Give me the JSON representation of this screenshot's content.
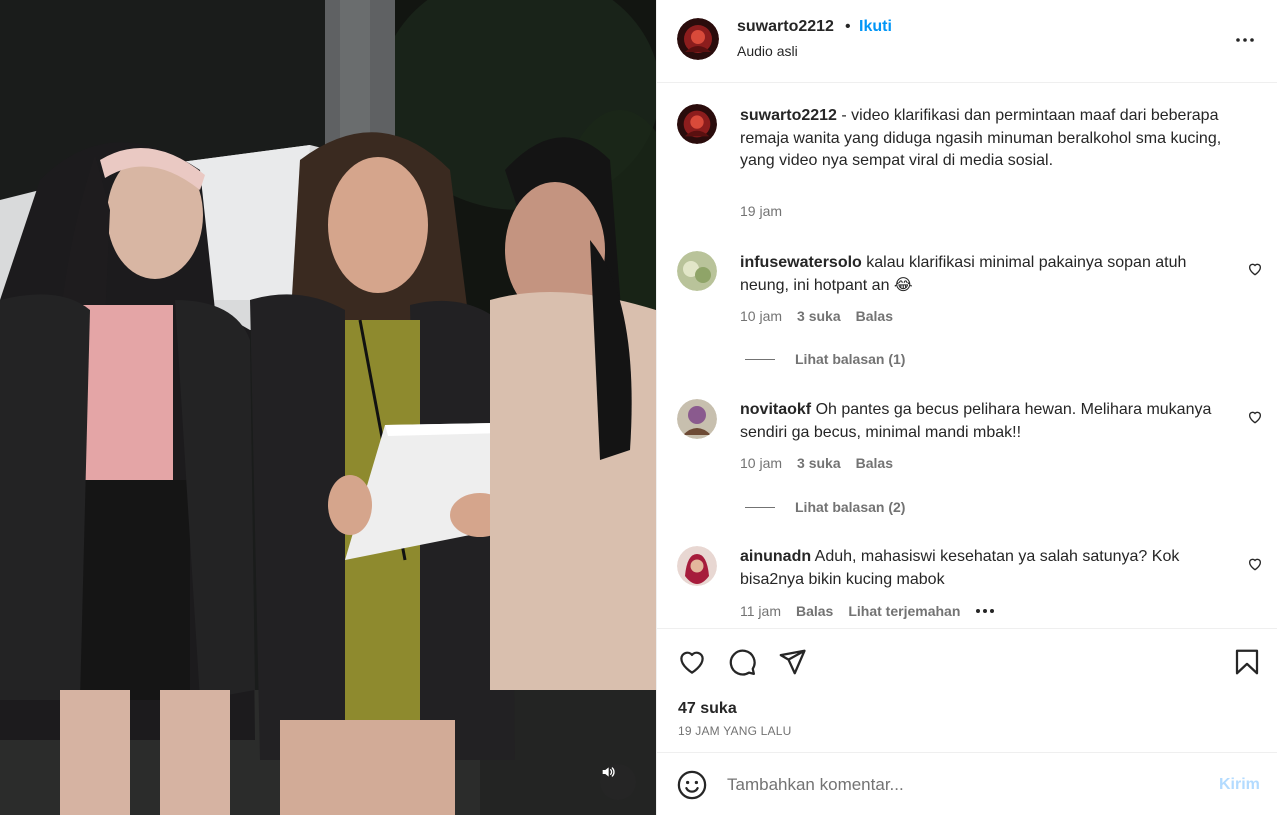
{
  "post": {
    "username": "suwarto2212",
    "dot": "•",
    "follow_label": "Ikuti",
    "audio_label": "Audio asli",
    "caption": {
      "username": "suwarto2212",
      "text": " - video klarifikasi dan permintaan maaf dari beberapa remaja wanita yang diduga ngasih minuman beralkohol sma kucing, yang video nya sempat viral di media sosial.",
      "time": "19 jam"
    },
    "comments": [
      {
        "username": "infusewatersolo",
        "text": " kalau klarifikasi minimal pakainya sopan atuh neung, ini hotpant an 😂",
        "time": "10 jam",
        "likes": "3 suka",
        "reply_label": "Balas",
        "view_replies": "Lihat balasan (1)"
      },
      {
        "username": "novitaokf",
        "text": " Oh pantes ga becus pelihara hewan. Melihara mukanya sendiri ga becus, minimal mandi mbak!!",
        "time": "10 jam",
        "likes": "3 suka",
        "reply_label": "Balas",
        "view_replies": "Lihat balasan (2)"
      },
      {
        "username": "ainunadn",
        "text": " Aduh, mahasiswi kesehatan ya salah satunya? Kok bisa2nya bikin kucing mabok",
        "time": "11 jam",
        "reply_label": "Balas",
        "translate_label": "Lihat terjemahan"
      }
    ],
    "like_count": "47 suka",
    "posted_ago": "19 JAM YANG LALU",
    "composer": {
      "placeholder": "Tambahkan komentar...",
      "post_label": "Kirim"
    }
  },
  "icons": {
    "more": "more-horizontal-icon",
    "like": "heart-icon",
    "comment": "comment-icon",
    "share": "share-icon",
    "save": "bookmark-icon",
    "emoji": "emoji-icon",
    "sound": "speaker-icon"
  },
  "colors": {
    "accent": "#0095f6",
    "post_disabled": "#b3dbff",
    "secondary_text": "#737373"
  }
}
